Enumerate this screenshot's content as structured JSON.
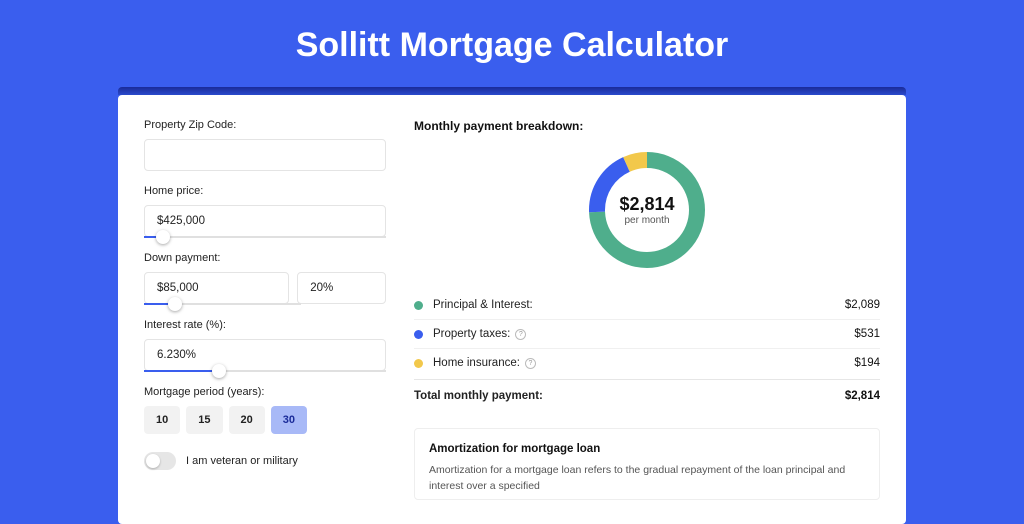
{
  "page": {
    "title": "Sollitt Mortgage Calculator"
  },
  "form": {
    "zip": {
      "label": "Property Zip Code:",
      "value": ""
    },
    "home_price": {
      "label": "Home price:",
      "value": "$425,000",
      "slider_pct": 8
    },
    "down_payment": {
      "label": "Down payment:",
      "amount": "$85,000",
      "percent": "20%",
      "slider_pct": 20
    },
    "interest": {
      "label": "Interest rate (%):",
      "value": "6.230%",
      "slider_pct": 31
    },
    "period": {
      "label": "Mortgage period (years):",
      "options": [
        "10",
        "15",
        "20",
        "30"
      ],
      "selected": "30"
    },
    "veteran": {
      "label": "I am veteran or military",
      "value": false
    }
  },
  "breakdown": {
    "title": "Monthly payment breakdown:",
    "center_value": "$2,814",
    "center_label": "per month",
    "items": [
      {
        "label": "Principal & Interest:",
        "value": "$2,089",
        "color": "#4fae8c",
        "has_help": false
      },
      {
        "label": "Property taxes:",
        "value": "$531",
        "color": "#3a5eee",
        "has_help": true
      },
      {
        "label": "Home insurance:",
        "value": "$194",
        "color": "#f2c84b",
        "has_help": true
      }
    ],
    "total": {
      "label": "Total monthly payment:",
      "value": "$2,814"
    }
  },
  "chart_data": {
    "type": "pie",
    "title": "Monthly payment breakdown",
    "series": [
      {
        "name": "Principal & Interest",
        "value": 2089,
        "color": "#4fae8c"
      },
      {
        "name": "Property taxes",
        "value": 531,
        "color": "#3a5eee"
      },
      {
        "name": "Home insurance",
        "value": 194,
        "color": "#f2c84b"
      }
    ],
    "total": 2814
  },
  "amort": {
    "title": "Amortization for mortgage loan",
    "text": "Amortization for a mortgage loan refers to the gradual repayment of the loan principal and interest over a specified"
  }
}
